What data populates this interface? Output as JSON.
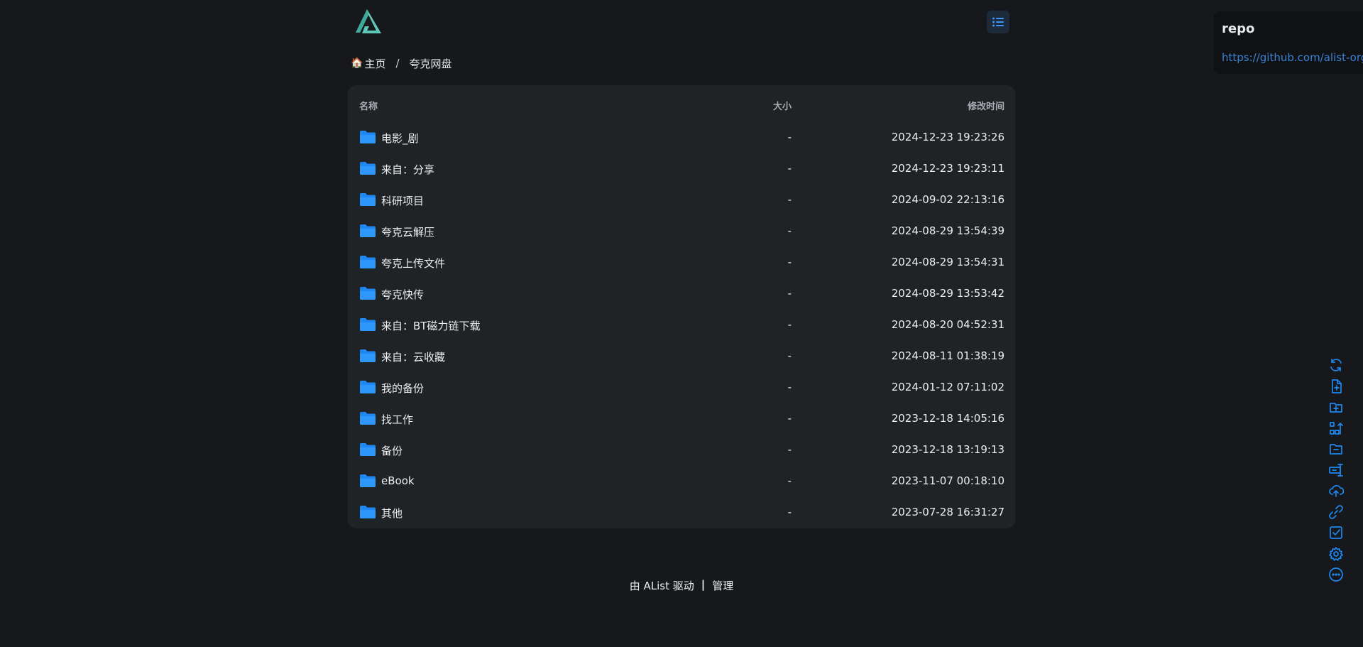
{
  "colors": {
    "background": "#16181b",
    "panel": "#202325",
    "accent": "#1e88f2",
    "logo": "#5ec8b8"
  },
  "header": {
    "logo_icon": "alist-logo",
    "layout_toggle_icon": "list-view-icon"
  },
  "breadcrumb": {
    "home_icon": "house-icon",
    "home_label": "主页",
    "separator": "/",
    "current": "夸克网盘"
  },
  "table": {
    "columns": {
      "name": "名称",
      "size": "大小",
      "modified": "修改时间"
    },
    "rows": [
      {
        "name": "电影_剧",
        "size": "-",
        "modified": "2024-12-23 19:23:26"
      },
      {
        "name": "来自：分享",
        "size": "-",
        "modified": "2024-12-23 19:23:11"
      },
      {
        "name": "科研项目",
        "size": "-",
        "modified": "2024-09-02 22:13:16"
      },
      {
        "name": "夸克云解压",
        "size": "-",
        "modified": "2024-08-29 13:54:39"
      },
      {
        "name": "夸克上传文件",
        "size": "-",
        "modified": "2024-08-29 13:54:31"
      },
      {
        "name": "夸克快传",
        "size": "-",
        "modified": "2024-08-29 13:53:42"
      },
      {
        "name": "来自：BT磁力链下载",
        "size": "-",
        "modified": "2024-08-20 04:52:31"
      },
      {
        "name": "来自：云收藏",
        "size": "-",
        "modified": "2024-08-11 01:38:19"
      },
      {
        "name": "我的备份",
        "size": "-",
        "modified": "2024-01-12 07:11:02"
      },
      {
        "name": "找工作",
        "size": "-",
        "modified": "2023-12-18 14:05:16"
      },
      {
        "name": "备份",
        "size": "-",
        "modified": "2023-12-18 13:19:13"
      },
      {
        "name": "eBook",
        "size": "-",
        "modified": "2023-11-07 00:18:10"
      },
      {
        "name": "其他",
        "size": "-",
        "modified": "2023-07-28 16:31:27"
      }
    ]
  },
  "footer": {
    "powered_by": "由 AList 驱动",
    "separator": "|",
    "manage": "管理"
  },
  "repo": {
    "title": "repo",
    "link": "https://github.com/alist-org/alist"
  },
  "toolbar": {
    "items": [
      {
        "name": "refresh-icon"
      },
      {
        "name": "new-file-icon"
      },
      {
        "name": "new-folder-icon"
      },
      {
        "name": "recursive-move-icon"
      },
      {
        "name": "remove-empty-folder-icon"
      },
      {
        "name": "batch-rename-icon"
      },
      {
        "name": "upload-icon"
      },
      {
        "name": "offline-download-icon"
      },
      {
        "name": "select-icon"
      },
      {
        "name": "settings-icon"
      },
      {
        "name": "more-icon"
      }
    ]
  }
}
